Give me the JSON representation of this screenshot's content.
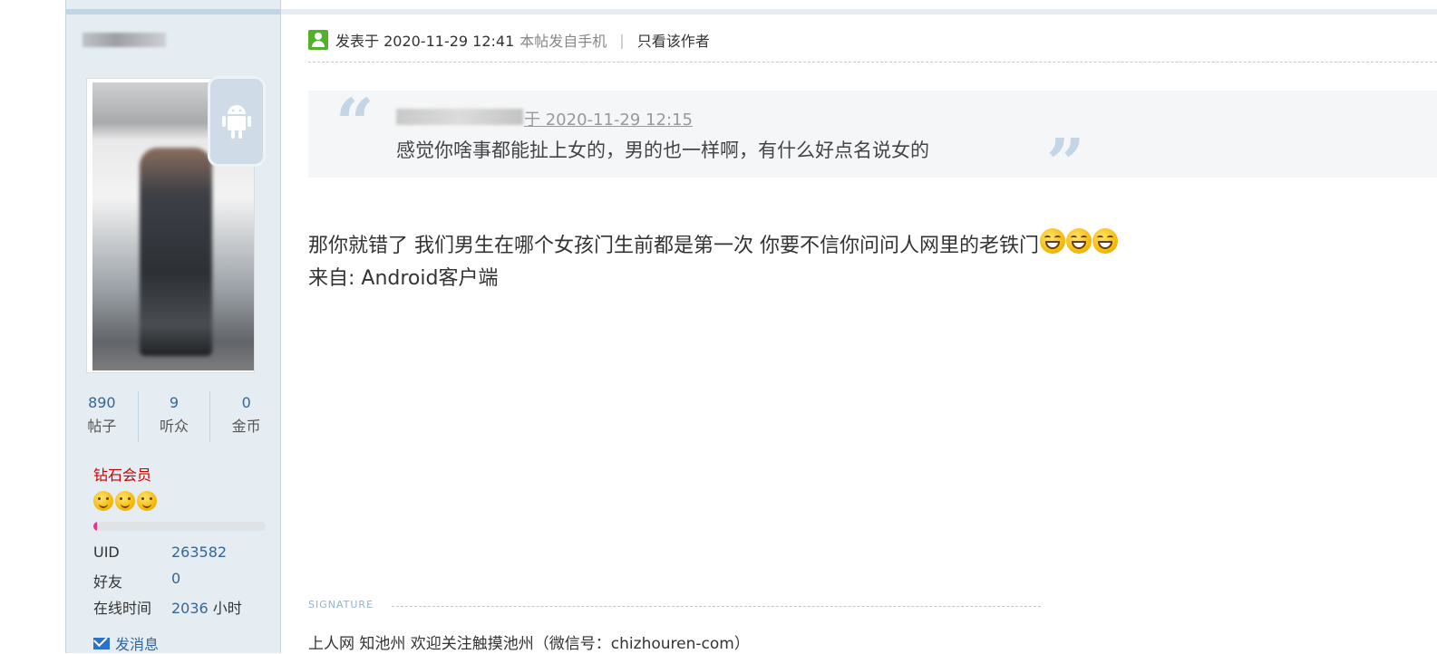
{
  "sidebar": {
    "stats": [
      {
        "value": "890",
        "label": "帖子"
      },
      {
        "value": "9",
        "label": "听众"
      },
      {
        "value": "0",
        "label": "金币"
      }
    ],
    "group_name": "钻石会员",
    "star_count": 3,
    "progress_fraction": 0.02,
    "info": [
      {
        "key": "UID",
        "value": "263582",
        "unit": ""
      },
      {
        "key": "好友",
        "value": "0",
        "unit": ""
      },
      {
        "key": "在线时间",
        "value": "2036",
        "unit": " 小时"
      }
    ],
    "send_message": "发消息"
  },
  "post": {
    "posted_at": "发表于 2020-11-29 12:41",
    "via_mobile": "本帖发自手机",
    "separator": "|",
    "only_author": "只看该作者",
    "quote": {
      "meta": "于 2020-11-29 12:15",
      "text": "感觉你啥事都能扯上女的，男的也一样啊，有什么好点名说女的"
    },
    "body_line1": "那你就错了 我们男生在哪个女孩门生前都是第一次 你要不信你问问人网里的老铁门",
    "body_line2": "来自: Android客户端",
    "laugh_emoji_count": 3
  },
  "signature": {
    "label": "SIGNATURE",
    "text": "上人网 知池州 欢迎关注触摸池州（微信号：chizhouren-com）"
  },
  "colors": {
    "sidebar_bg": "#e5edf2",
    "link": "#336699",
    "group": "#cc0000",
    "progress": "#e9338f"
  }
}
